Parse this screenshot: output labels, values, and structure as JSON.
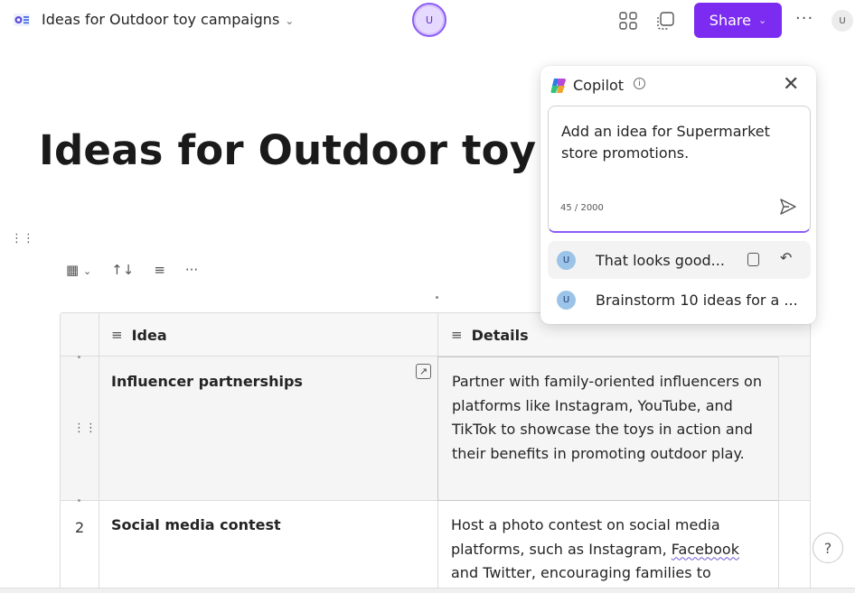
{
  "topbar": {
    "doc_title": "Ideas for Outdoor toy campaigns",
    "avatar_initial": "U",
    "share_label": "Share",
    "more_label": "···",
    "user_initial": "U"
  },
  "page": {
    "heading": "Ideas for Outdoor toy ca"
  },
  "table": {
    "toolbar_more": "···",
    "columns": [
      {
        "label": "Idea"
      },
      {
        "label": "Details"
      }
    ],
    "rows": [
      {
        "number": "",
        "idea": "Influencer partnerships",
        "details": "Partner with family-oriented influencers on platforms like Instagram, YouTube, and TikTok to showcase the toys in action and their benefits in promoting outdoor play."
      },
      {
        "number": "2",
        "idea": "Social media contest",
        "details_before": "Host a photo contest on social media platforms, such as Instagram, ",
        "details_spell": "Facebook",
        "details_after": " and Twitter, encouraging families to"
      }
    ]
  },
  "copilot": {
    "title": "Copilot",
    "input_text": "Add an idea for Supermarket store promotions.",
    "char_count": "45 / 2000",
    "suggestions": [
      {
        "initial": "U",
        "text": "That looks good..."
      },
      {
        "initial": "U",
        "text": "Brainstorm 10 ideas for a ..."
      }
    ]
  },
  "help_label": "?",
  "colors": {
    "accent": "#7b2cf0",
    "row_highlight": "#f5f5f5"
  }
}
